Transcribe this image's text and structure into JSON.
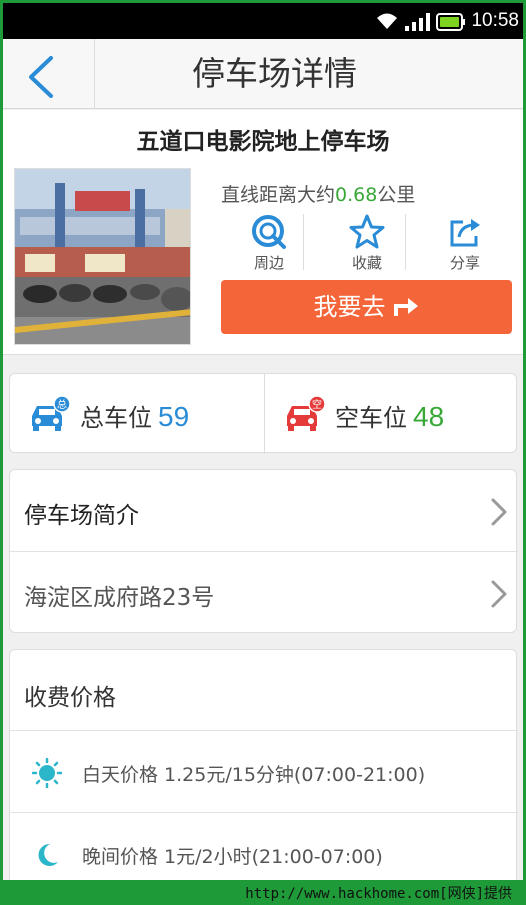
{
  "status_bar": {
    "time": "10:58"
  },
  "header": {
    "title": "停车场详情"
  },
  "lot": {
    "name": "五道口电影院地上停车场",
    "distance_prefix": "直线距离大约",
    "distance_value": "0.68",
    "distance_unit": "公里"
  },
  "actions": [
    {
      "label": "周边",
      "icon": "nearby-icon"
    },
    {
      "label": "收藏",
      "icon": "star-icon"
    },
    {
      "label": "分享",
      "icon": "share-icon"
    }
  ],
  "go_button": {
    "label": "我要去"
  },
  "spaces": {
    "total_label": "总车位",
    "total_value": "59",
    "total_badge": "总",
    "free_label": "空车位",
    "free_value": "48",
    "free_badge": "空"
  },
  "list": {
    "intro": "停车场简介",
    "address": "海淀区成府路23号"
  },
  "fees": {
    "title": "收费价格",
    "day": "白天价格  1.25元/15分钟(07:00-21:00)",
    "night": "晚间价格  1元/2小时(21:00-07:00)"
  },
  "footer": {
    "credit": "http://www.hackhome.com[网侠]提供"
  },
  "colors": {
    "accent_blue": "#2a8bd6",
    "go_orange": "#f4663a",
    "green": "#3aa838",
    "red": "#e53a3a",
    "footer_green": "#1e9a38"
  }
}
